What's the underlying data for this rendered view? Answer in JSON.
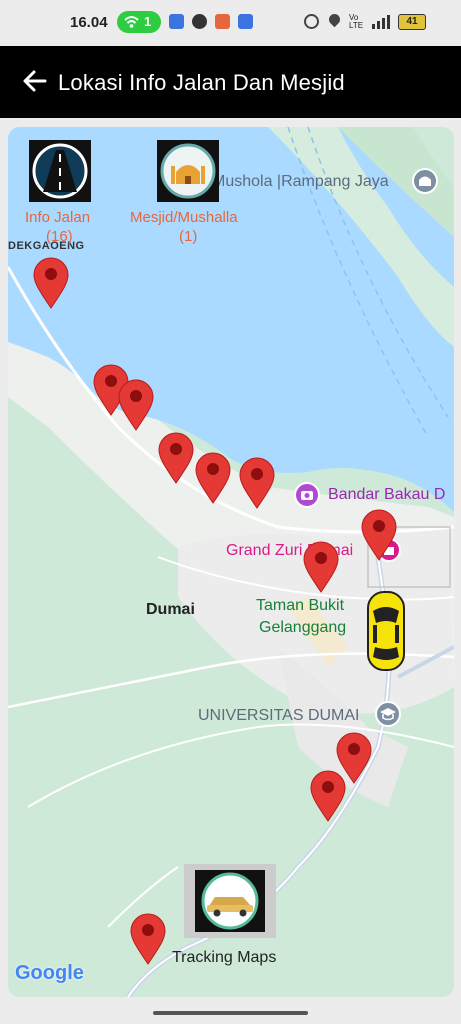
{
  "status_bar": {
    "time": "16.04",
    "wifi_count": "1",
    "battery": "41"
  },
  "app_bar": {
    "title": "Lokasi Info Jalan Dan Mesjid"
  },
  "map": {
    "place_labels": {
      "mushola": "Mushola |Rampang Jaya",
      "dekgaoeng": "DEKGAOENG",
      "bandar": "Bandar Bakau D",
      "grand": "Grand Zuri Dumai",
      "taman_line1": "Taman Bukit",
      "taman_line2": "Gelanggang",
      "dumai": "Dumai",
      "universitas": "UNIVERSITAS DUMAI"
    },
    "google_logo": "Google",
    "colors": {
      "water": "#aadaff",
      "land": "#cfe9d9",
      "urban": "#eeeeee",
      "pin": "#e53935",
      "poi_purple": "#9c27b0",
      "poi_green": "#188038",
      "label_orange": "#e8663c"
    }
  },
  "buttons": {
    "info_jalan_line1": "Info Jalan",
    "info_jalan_line2": "(16)",
    "mesjid_line1": "Mesjid/Mushalla",
    "mesjid_line2": "(1)",
    "tracking": "Tracking Maps"
  }
}
